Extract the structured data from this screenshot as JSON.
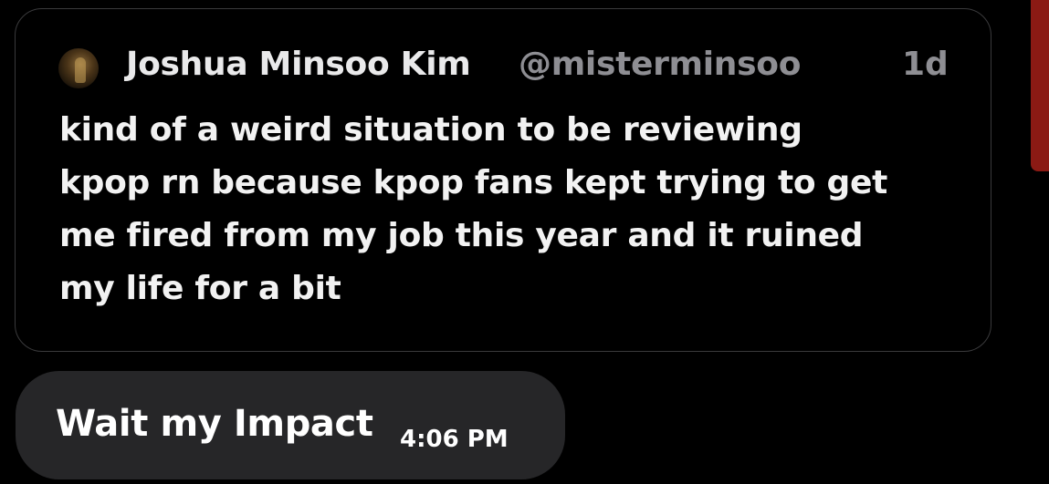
{
  "quoted_post": {
    "author_name": "Joshua Minsoo Kim",
    "author_handle": "@misterminsoo",
    "age": "1d",
    "text_lines": [
      "kind of a weird situation to be reviewing",
      "kpop rn because kpop fans kept trying to get",
      "me fired from my job this year and it ruined",
      "my life for a bit"
    ]
  },
  "message": {
    "text": "Wait my Impact",
    "time": "4:06 PM"
  },
  "colors": {
    "background": "#000000",
    "card_border": "#3a3a3c",
    "bubble": "#262628",
    "secondary_text": "#8e8e93",
    "edge_accent": "#8b1a14"
  }
}
